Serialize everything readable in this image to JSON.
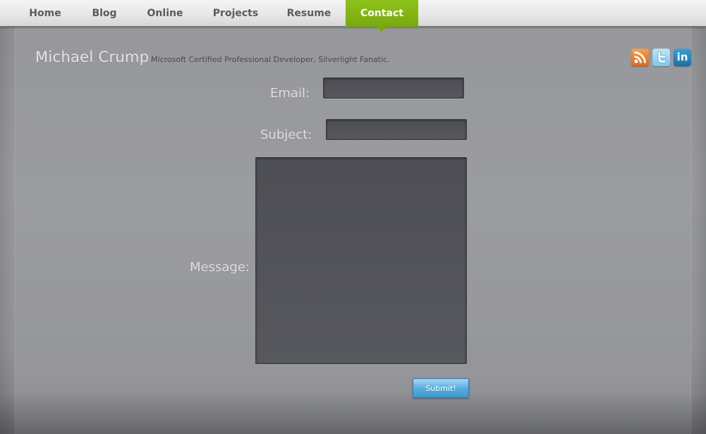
{
  "nav": {
    "items": [
      {
        "label": "Home"
      },
      {
        "label": "Blog"
      },
      {
        "label": "Online"
      },
      {
        "label": "Projects"
      },
      {
        "label": "Resume"
      },
      {
        "label": "Contact",
        "active": true
      }
    ],
    "active_color": "#7fb314"
  },
  "header": {
    "site_name": "Michael Crump",
    "tagline": "Microsoft Certified Professional Developer, Silverlight Fanatic."
  },
  "social": {
    "icons": [
      "rss-icon",
      "twitter-icon",
      "linkedin-icon"
    ],
    "linkedin_text": "in"
  },
  "form": {
    "email_label": "Email:",
    "email_value": "",
    "subject_label": "Subject:",
    "subject_value": "",
    "message_label": "Message:",
    "message_value": "",
    "submit_label": "Submit!"
  },
  "colors": {
    "background": "#999a9d",
    "field": "#525358",
    "submit": "#4aa3d8"
  }
}
